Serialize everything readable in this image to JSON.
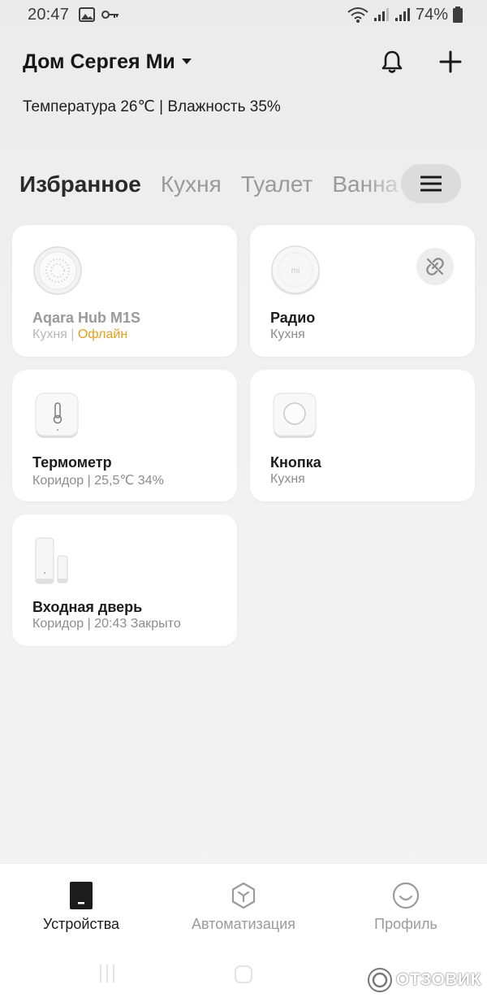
{
  "status_bar": {
    "time": "20:47",
    "battery": "74%",
    "icons": [
      "image-icon",
      "key-icon",
      "wifi-icon",
      "signal-icon",
      "signal-icon",
      "battery-icon"
    ]
  },
  "header": {
    "home_name": "Дом Сергея Ми",
    "climate": "Температура 26℃ | Влажность 35%"
  },
  "tabs": [
    {
      "label": "Избранное",
      "active": true
    },
    {
      "label": "Кухня"
    },
    {
      "label": "Туалет"
    },
    {
      "label": "Ванна"
    }
  ],
  "devices": [
    {
      "name": "Aqara Hub M1S",
      "room": "Кухня",
      "separator": "|",
      "status": "Офлайн",
      "status_color": "#e2a11a",
      "icon": "hub-icon"
    },
    {
      "name": "Радио",
      "room": "Кухня",
      "icon": "speaker-icon",
      "badge": "unlink-icon"
    },
    {
      "name": "Термометр",
      "room": "Коридор | 25,5℃ 34%",
      "icon": "thermometer-icon"
    },
    {
      "name": "Кнопка",
      "room": "Кухня",
      "icon": "button-icon"
    },
    {
      "name": "Входная дверь",
      "room": "Коридор | 20:43 Закрыто",
      "icon": "door-sensor-icon"
    }
  ],
  "bottom_nav": [
    {
      "label": "Устройства",
      "icon": "devices-icon",
      "active": true
    },
    {
      "label": "Автоматизация",
      "icon": "automation-icon"
    },
    {
      "label": "Профиль",
      "icon": "profile-icon"
    }
  ],
  "watermark": "ОТЗОВИК",
  "colors": {
    "accent_offline": "#e2a11a",
    "card_bg": "#ffffff",
    "page_bg": "#efefef"
  }
}
